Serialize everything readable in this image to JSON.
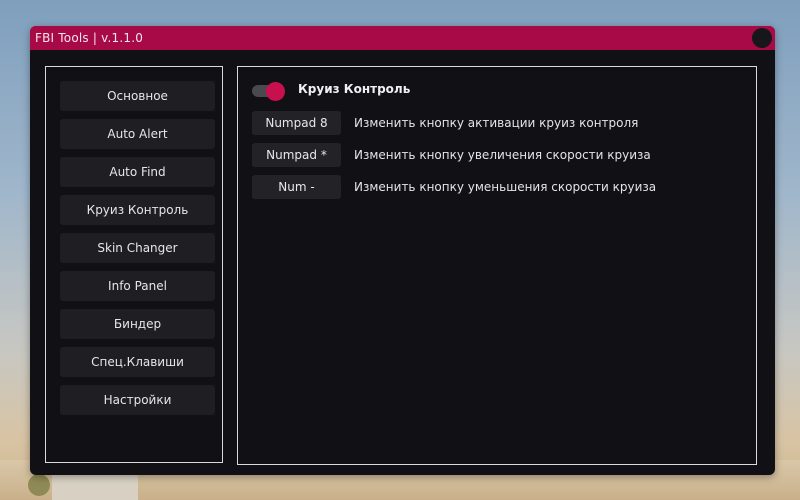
{
  "window": {
    "title": "FBI Tools | v.1.1.0"
  },
  "colors": {
    "accent": "#a80a48",
    "panel_bg": "#111015",
    "item_bg": "#1f1e23",
    "border": "#d9d9de"
  },
  "sidebar": {
    "items": [
      {
        "label": "Основное"
      },
      {
        "label": "Auto Alert"
      },
      {
        "label": "Auto Find"
      },
      {
        "label": "Круиз Контроль"
      },
      {
        "label": "Skin Changer"
      },
      {
        "label": "Info Panel"
      },
      {
        "label": "Биндер"
      },
      {
        "label": "Спец.Клавиши"
      },
      {
        "label": "Настройки"
      }
    ]
  },
  "content": {
    "toggle": {
      "label": "Круиз Контроль",
      "enabled": true
    },
    "keybinds": [
      {
        "key": "Numpad 8",
        "description": "Изменить кнопку активации круиз контроля"
      },
      {
        "key": "Numpad *",
        "description": "Изменить кнопку увеличения скорости круиза"
      },
      {
        "key": "Num -",
        "description": "Изменить кнопку уменьшения скорости круиза"
      }
    ]
  }
}
